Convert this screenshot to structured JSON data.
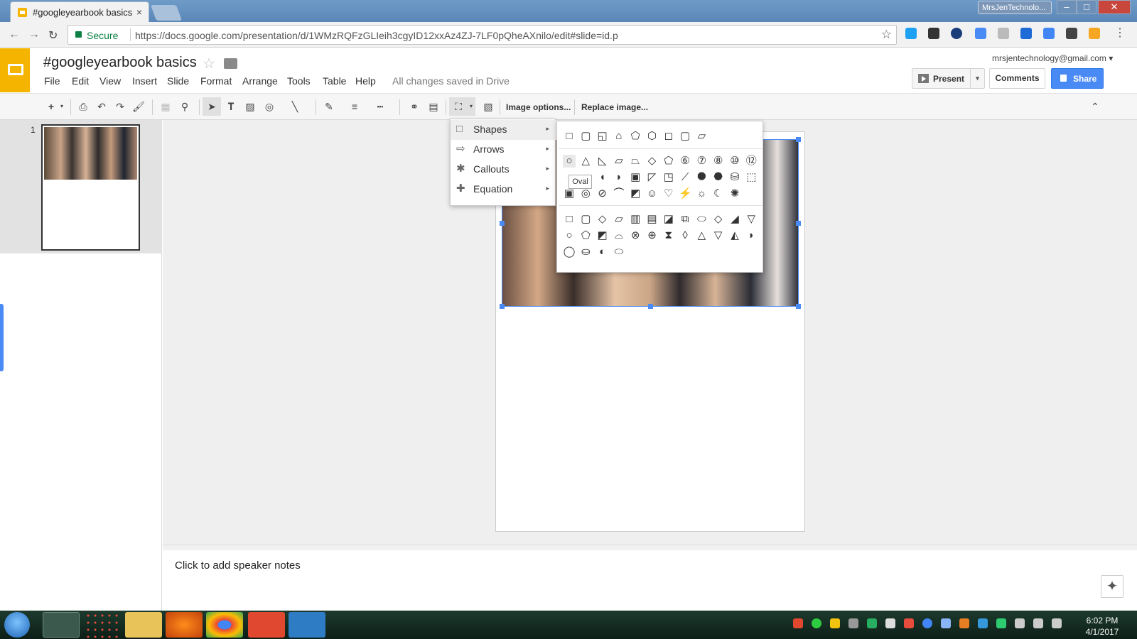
{
  "browser": {
    "tab_title": "#googleyearbook basics",
    "tab_close": "×",
    "user_badge": "MrsJenTechnolo...",
    "window_controls": {
      "minimize": "–",
      "maximize": "□",
      "close": "✕"
    },
    "nav": {
      "back": "←",
      "forward": "→",
      "reload": "↻"
    },
    "secure_label": "Secure",
    "url": "https://docs.google.com/presentation/d/1WMzRQFzGLIeih3cgyID12xxAz4ZJ-7LF0pQheAXnilo/edit#slide=id.p",
    "bookmark_star": "☆"
  },
  "app": {
    "doc_title": "#googleyearbook basics",
    "star": "☆",
    "menus": [
      "File",
      "Edit",
      "View",
      "Insert",
      "Slide",
      "Format",
      "Arrange",
      "Tools",
      "Table",
      "Help"
    ],
    "saved_status": "All changes saved in Drive",
    "account_email": "mrsjentechnology@gmail.com",
    "account_caret": "▾",
    "present_label": "Present",
    "present_caret": "▾",
    "comments_label": "Comments",
    "share_label": "Share",
    "brand_color": "#f4b400",
    "share_color": "#4a8af4"
  },
  "toolbar": {
    "new_slide": "+",
    "image_options_label": "Image options...",
    "replace_image_label": "Replace image...",
    "collapse": "⌃"
  },
  "slides": {
    "numbers": [
      "1"
    ]
  },
  "mask_menu": {
    "items": [
      {
        "label": "Shapes",
        "icon": "□",
        "arrow": "▸"
      },
      {
        "label": "Arrows",
        "icon": "⇨",
        "arrow": "▸"
      },
      {
        "label": "Callouts",
        "icon": "✱",
        "arrow": "▸"
      },
      {
        "label": "Equation",
        "icon": "✚",
        "arrow": "▸"
      }
    ]
  },
  "shapes_submenu": {
    "row1": [
      "□",
      "▢",
      "◱",
      "⌂",
      "⬠",
      "⬡",
      "◻",
      "▢",
      "▱"
    ],
    "row2": [
      "○",
      "△",
      "◺",
      "▱",
      "⏢",
      "◇",
      "⬠",
      "⑥",
      "⑦",
      "⑧",
      "⑩",
      "⑫"
    ],
    "row3": [
      "◔",
      "◌",
      "◖",
      "◗",
      "▣",
      "◸",
      "◳",
      "⟋",
      "⯃",
      "⯄",
      "⛁",
      "⬚"
    ],
    "row4": [
      "▣",
      "◎",
      "⊘",
      "⌒",
      "◩",
      "☺",
      "♡",
      "⚡",
      "☼",
      "☾",
      "✺"
    ],
    "row5": [
      "□",
      "▢",
      "◇",
      "▱",
      "▥",
      "▤",
      "◪",
      "⧉",
      "⬭",
      "◇",
      "◢",
      "▽"
    ],
    "row6": [
      "○",
      "⬠",
      "◩",
      "⌓",
      "⊗",
      "⊕",
      "⧗",
      "◊",
      "△",
      "▽",
      "◭",
      "◗"
    ],
    "row7": [
      "◯",
      "⛀",
      "◐",
      "⬭"
    ],
    "tooltip": "Oval"
  },
  "notes": {
    "placeholder": "Click to add speaker notes",
    "explore_icon": "✦"
  },
  "taskbar": {
    "time": "6:02 PM",
    "date": "4/1/2017"
  }
}
